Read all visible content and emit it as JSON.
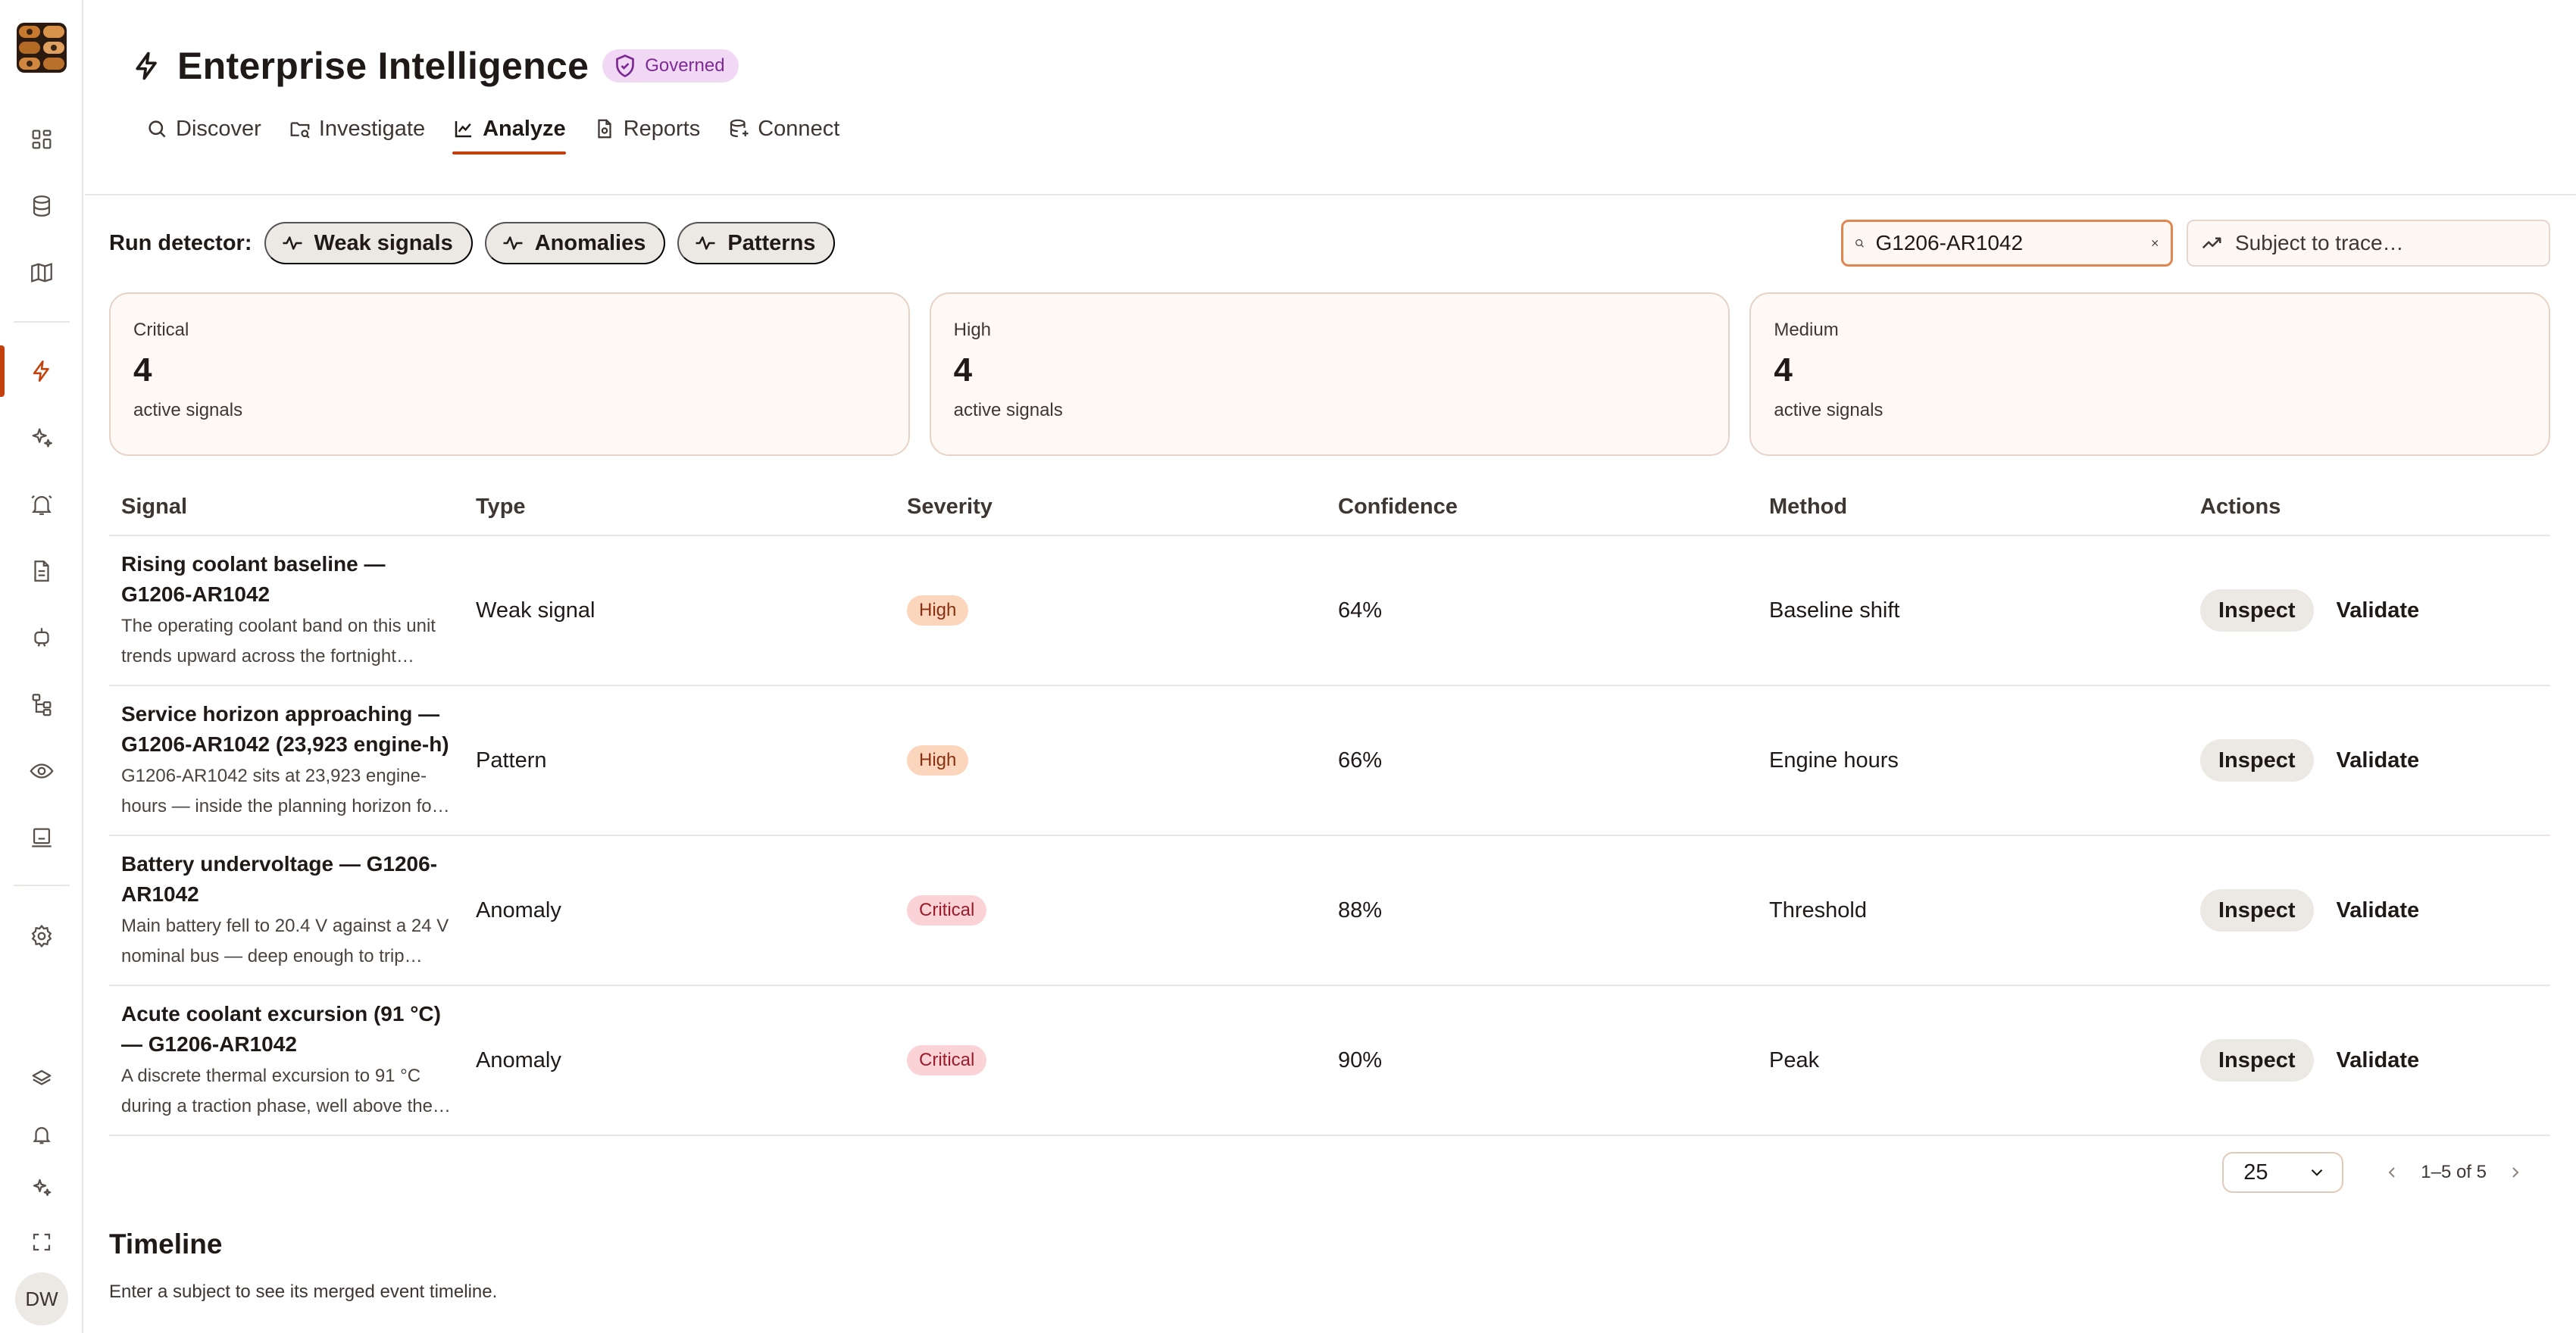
{
  "app": {
    "title": "Enterprise Intelligence",
    "badge": "Governed",
    "accent_color": "#c2410c"
  },
  "sidebar": {
    "items": [
      {
        "icon": "dashboard-icon",
        "active": false
      },
      {
        "icon": "database-icon",
        "active": false
      },
      {
        "icon": "map-icon",
        "active": false
      },
      {
        "icon": "lightning-icon",
        "active": true
      },
      {
        "icon": "sparkles-icon",
        "active": false
      },
      {
        "icon": "bell-icon",
        "active": false
      },
      {
        "icon": "document-icon",
        "active": false
      },
      {
        "icon": "robot-icon",
        "active": false
      },
      {
        "icon": "hierarchy-icon",
        "active": false
      },
      {
        "icon": "eye-icon",
        "active": false
      },
      {
        "icon": "monitor-icon",
        "active": false
      },
      {
        "icon": "settings-icon",
        "active": false
      },
      {
        "icon": "layers-icon",
        "active": false
      },
      {
        "icon": "notification-icon",
        "active": false
      },
      {
        "icon": "assistant-icon",
        "active": false
      },
      {
        "icon": "fullscreen-icon",
        "active": false
      }
    ],
    "avatar_initials": "DW"
  },
  "tabs": [
    {
      "label": "Discover",
      "icon": "search-icon",
      "active": false
    },
    {
      "label": "Investigate",
      "icon": "folder-search-icon",
      "active": false
    },
    {
      "label": "Analyze",
      "icon": "chart-icon",
      "active": true
    },
    {
      "label": "Reports",
      "icon": "report-icon",
      "active": false
    },
    {
      "label": "Connect",
      "icon": "connect-icon",
      "active": false
    }
  ],
  "toolbar": {
    "run_label": "Run detector:",
    "detectors": [
      "Weak signals",
      "Anomalies",
      "Patterns"
    ],
    "search_value": "G1206-AR1042",
    "trace_placeholder": "Subject to trace…"
  },
  "cards": [
    {
      "label": "Critical",
      "value": "4",
      "sub": "active signals"
    },
    {
      "label": "High",
      "value": "4",
      "sub": "active signals"
    },
    {
      "label": "Medium",
      "value": "4",
      "sub": "active signals"
    }
  ],
  "table": {
    "headers": {
      "signal": "Signal",
      "type": "Type",
      "severity": "Severity",
      "confidence": "Confidence",
      "method": "Method",
      "actions": "Actions"
    },
    "rows": [
      {
        "title": "Rising coolant baseline — G1206-AR1042",
        "desc": "The operating coolant band on this unit trends upward across the fortnight…",
        "type": "Weak signal",
        "severity": "High",
        "confidence": "64%",
        "method": "Baseline shift"
      },
      {
        "title": "Service horizon approaching — G1206-AR1042 (23,923 engine-h)",
        "desc": "G1206-AR1042 sits at 23,923 engine-hours — inside the planning horizon fo…",
        "type": "Pattern",
        "severity": "High",
        "confidence": "66%",
        "method": "Engine hours"
      },
      {
        "title": "Battery undervoltage — G1206-AR1042",
        "desc": "Main battery fell to 20.4 V against a 24 V nominal bus — deep enough to trip…",
        "type": "Anomaly",
        "severity": "Critical",
        "confidence": "88%",
        "method": "Threshold"
      },
      {
        "title": "Acute coolant excursion (91 °C) — G1206-AR1042",
        "desc": "A discrete thermal excursion to 91 °C during a traction phase, well above the…",
        "type": "Anomaly",
        "severity": "Critical",
        "confidence": "90%",
        "method": "Peak"
      }
    ],
    "inspect_label": "Inspect",
    "validate_label": "Validate"
  },
  "pagination": {
    "page_size": "25",
    "range": "1–5 of 5"
  },
  "timeline": {
    "title": "Timeline",
    "hint": "Enter a subject to see its merged event timeline."
  }
}
